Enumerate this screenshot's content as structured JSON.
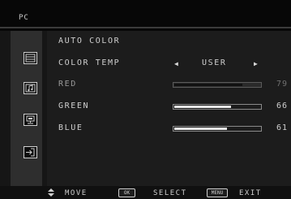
{
  "menu_title": "PC",
  "sidebar": {
    "icons": [
      "picture-icon",
      "audio-icon",
      "display-icon",
      "input-icon"
    ]
  },
  "rows": [
    {
      "label": "AUTO COLOR"
    },
    {
      "label": "COLOR TEMP",
      "value": "USER"
    },
    {
      "label": "RED",
      "value": "79",
      "level": 79
    },
    {
      "label": "GREEN",
      "value": "66",
      "level": 66
    },
    {
      "label": "BLUE",
      "value": "61",
      "level": 61
    }
  ],
  "footer": {
    "move_label": "MOVE",
    "ok_key": "OK",
    "select_label": "SELECT",
    "menu_key": "MENU",
    "exit_label": "EXIT"
  },
  "colors": {
    "background": "#1c1c1c",
    "text": "#cfcfcf",
    "bar_fill": "#e8e8e8"
  }
}
